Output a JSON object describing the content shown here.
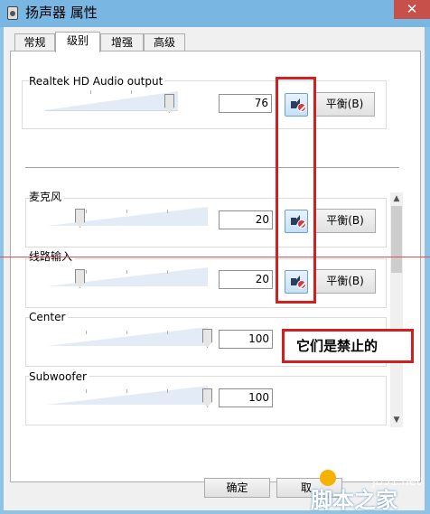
{
  "window": {
    "title": "扬声器 属性",
    "close_glyph": "✕"
  },
  "tabs": [
    {
      "label": "常规"
    },
    {
      "label": "级别",
      "active": true
    },
    {
      "label": "增强"
    },
    {
      "label": "高级"
    }
  ],
  "channels": [
    {
      "name": "Realtek HD Audio output",
      "value": "76",
      "level": 76,
      "muted": true,
      "balance_label": "平衡(B)"
    },
    {
      "name": "麦克风",
      "value": "20",
      "level": 20,
      "muted": true,
      "balance_label": "平衡(B)"
    },
    {
      "name": "线路输入",
      "value": "20",
      "level": 20,
      "muted": true,
      "balance_label": "平衡(B)"
    },
    {
      "name": "Center",
      "value": "100",
      "level": 100
    },
    {
      "name": "Subwoofer",
      "value": "100",
      "level": 100
    }
  ],
  "footer": {
    "ok_label": "确定",
    "cancel_label": "取"
  },
  "scrollbar": {
    "up_glyph": "▲",
    "down_glyph": "▼"
  },
  "annotation": {
    "callout_text": "它们是禁止的"
  },
  "watermark": {
    "site": "jb51.net",
    "logo_text": "脚本之家"
  },
  "colors": {
    "highlight": "#d21f1f",
    "mute_icon": "#d3393d",
    "window_frame": "#8fc3e6"
  }
}
